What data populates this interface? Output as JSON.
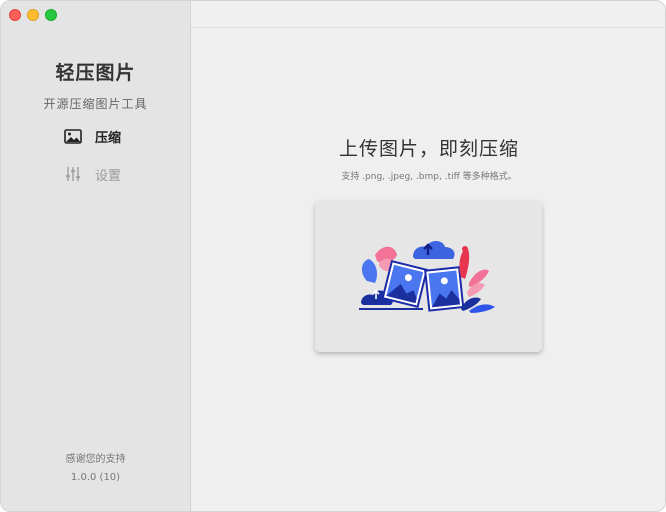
{
  "window": {
    "traffic_lights": [
      "close",
      "minimize",
      "zoom"
    ]
  },
  "sidebar": {
    "title": "轻压图片",
    "subtitle": "开源压缩图片工具",
    "items": [
      {
        "label": "压缩",
        "icon": "image-icon",
        "active": true
      },
      {
        "label": "设置",
        "icon": "sliders-icon",
        "active": false
      }
    ],
    "thanks": "感谢您的支持",
    "version": "1.0.0 (10)"
  },
  "main": {
    "headline": "上传图片，即刻压缩",
    "hint": "支持 .png, .jpeg, .bmp, .tiff 等多种格式。",
    "dropzone_icon": "upload-images-illustration"
  },
  "colors": {
    "accent_blue": "#2f55e8",
    "accent_pink": "#f27397",
    "accent_red": "#e8344f",
    "sidebar_bg": "#e4e4e4",
    "main_bg": "#efefef"
  }
}
